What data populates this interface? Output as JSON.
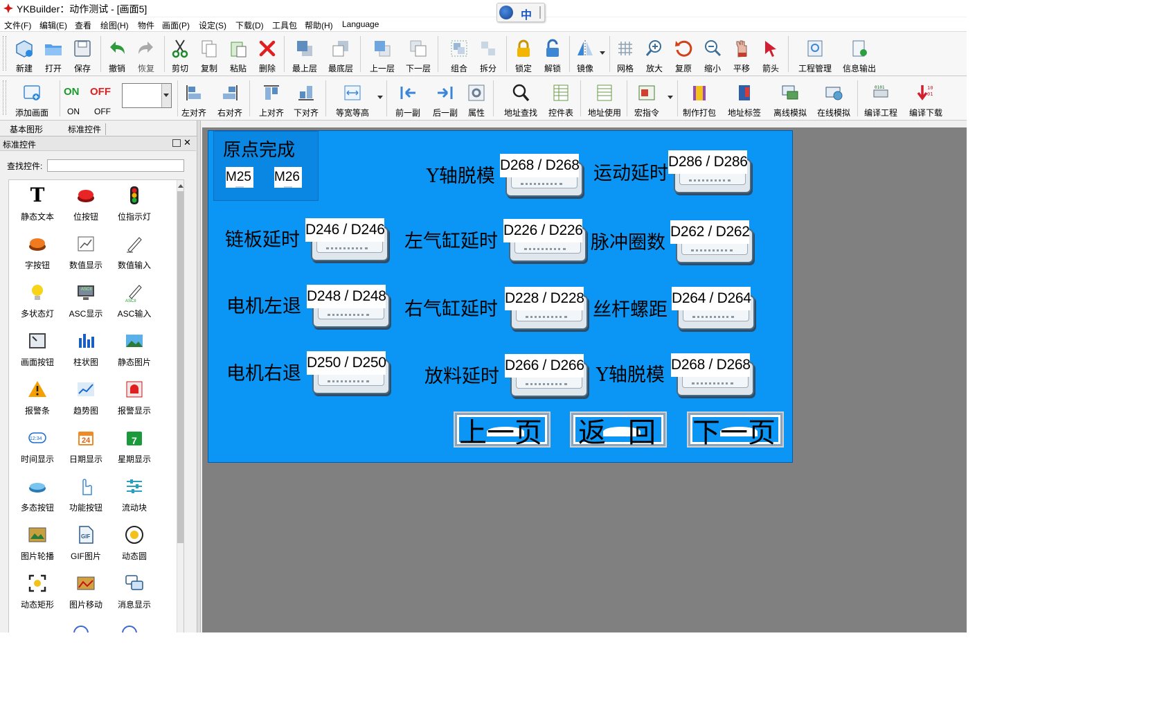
{
  "window": {
    "title": "YKBuilder：动作测试 - [画面5]"
  },
  "ime": {
    "label": "中"
  },
  "menu": [
    "文件(F)",
    "编辑(E)",
    "查看",
    "绘图(H)",
    "物件",
    "画面(P)",
    "设定(S)",
    "下载(D)",
    "工具包",
    "帮助(H)",
    "Language"
  ],
  "toolbar1": [
    "新建",
    "打开",
    "保存",
    "撤销",
    "恢复",
    "剪切",
    "复制",
    "粘贴",
    "删除",
    "最上层",
    "最底层",
    "上一层",
    "下一层",
    "组合",
    "拆分",
    "锁定",
    "解锁",
    "镜像",
    "网格",
    "放大",
    "复原",
    "缩小",
    "平移",
    "箭头",
    "工程管理",
    "信息输出"
  ],
  "toolbar2": {
    "add_screen": "添加画面",
    "on_label": "ON",
    "off_label": "OFF",
    "on_icon_text": "ON",
    "off_icon_text": "OFF",
    "buttons": [
      "左对齐",
      "右对齐",
      "上对齐",
      "下对齐",
      "等宽等高",
      "前一副",
      "后一副",
      "属性",
      "地址查找",
      "控件表",
      "地址使用",
      "宏指令",
      "制作打包",
      "地址标签",
      "离线模拟",
      "在线模拟",
      "编译工程",
      "编译下载"
    ]
  },
  "left_tabs": [
    "基本图形",
    "标准控件"
  ],
  "panel": {
    "title": "标准控件",
    "search_label": "查找控件:",
    "search_value": "",
    "controls": [
      "静态文本",
      "位按钮",
      "位指示灯",
      "字按钮",
      "数值显示",
      "数值输入",
      "多状态灯",
      "ASC显示",
      "ASC输入",
      "画面按钮",
      "柱状图",
      "静态图片",
      "报警条",
      "趋势图",
      "报警显示",
      "时间显示",
      "日期显示",
      "星期显示",
      "多态按钮",
      "功能按钮",
      "流动块",
      "图片轮播",
      "GIF图片",
      "动态圆",
      "动态矩形",
      "图片移动",
      "消息显示"
    ],
    "icon_text": {
      "static_text": "T",
      "ascii": "ASCII",
      "clock": "12:34",
      "calendar": "24",
      "week": "7",
      "gif": "GIF"
    }
  },
  "screen": {
    "origin_title": "原点完成",
    "origin_bits": [
      "M25",
      "M26"
    ],
    "labels": {
      "y_demold_top": "Y轴脱模",
      "motion_delay": "运动延时",
      "chain_delay": "链板延时",
      "left_cyl_delay": "左气缸延时",
      "pulse_turns": "脉冲圈数",
      "motor_left": "电机左退",
      "right_cyl_delay": "右气缸延时",
      "screw_pitch": "丝杆螺距",
      "motor_right": "电机右退",
      "discharge_delay": "放料延时",
      "y_demold_bottom": "Y轴脱模"
    },
    "fields": {
      "y_demold_top": "D268 / D268",
      "motion_delay": "D286 / D286",
      "chain_delay": "D246 / D246",
      "left_cyl_delay": "D226 / D226",
      "pulse_turns": "D262 / D262",
      "motor_left": "D248 / D248",
      "right_cyl_delay": "D228 / D228",
      "screw_pitch": "D264 / D264",
      "motor_right": "D250 / D250",
      "discharge_delay": "D266 / D266",
      "y_demold_bottom": "D268 / D268"
    },
    "nav": {
      "prev": "上一页",
      "back": "返回",
      "next": "下一页"
    }
  },
  "colors": {
    "screen_bg": "#0b96f5",
    "workspace_bg": "#808080",
    "accent_red": "#e02020",
    "accent_green": "#1a9a2a"
  }
}
